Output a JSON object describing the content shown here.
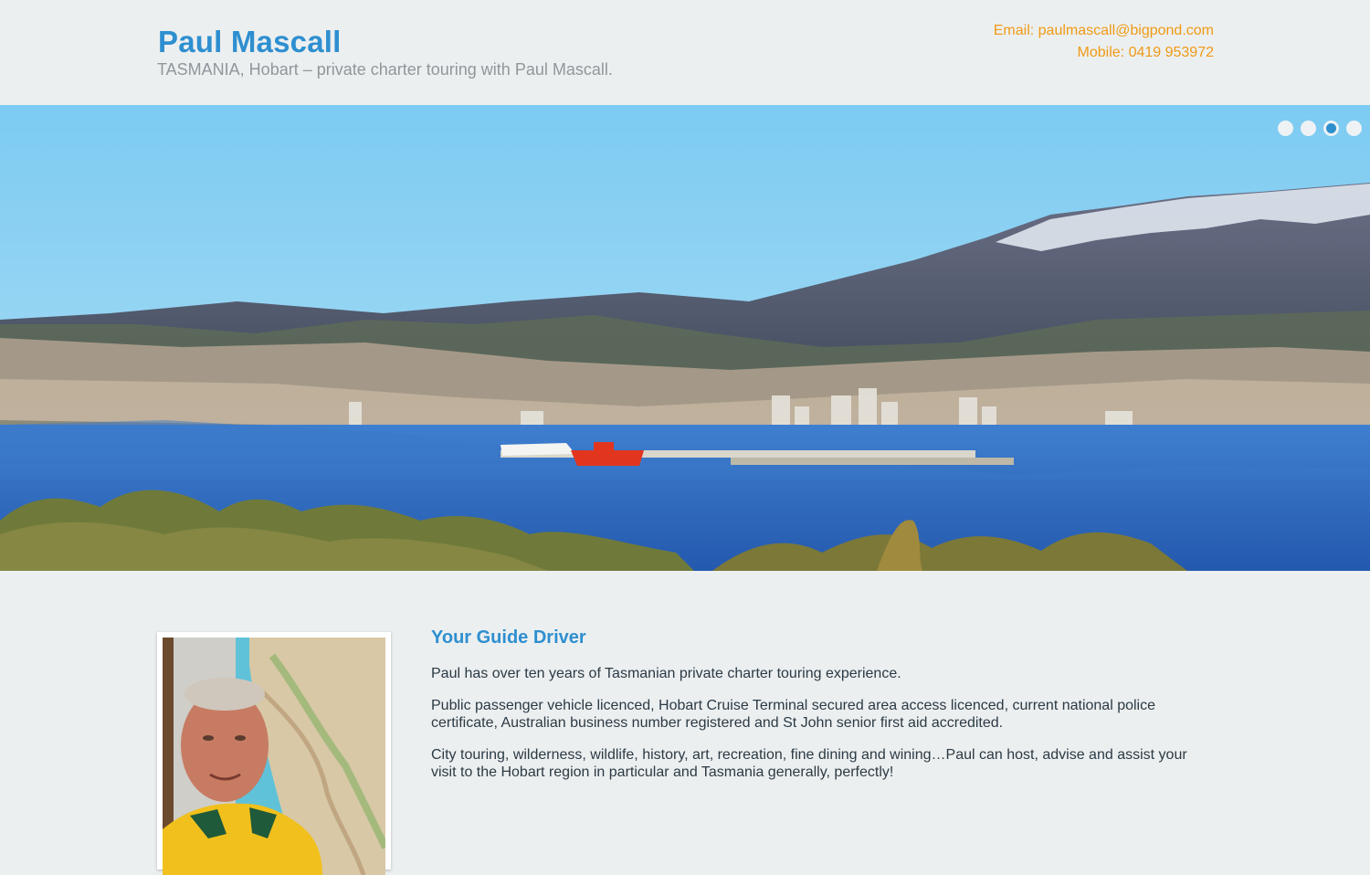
{
  "header": {
    "title": "Paul Mascall",
    "tagline": "TASMANIA, Hobart – private charter touring with Paul Mascall.",
    "email_label": "Email: ",
    "email": "paulmascall@bigpond.com",
    "mobile_label": "Mobile: ",
    "mobile": "0419 953972"
  },
  "slider": {
    "slide_count": 4,
    "active_index": 2
  },
  "main": {
    "section_title": "Your Guide Driver",
    "paragraphs": [
      "Paul has over ten years of Tasmanian private charter touring experience.",
      "Public passenger vehicle licenced, Hobart Cruise Terminal secured area access licenced, current national police certificate, Australian business number registered and St John senior first aid accredited.",
      "City touring, wilderness, wildlife, history, art, recreation, fine dining and wining…Paul can host, advise and assist your visit to the Hobart region in particular and Tasmania generally, perfectly!"
    ]
  },
  "colors": {
    "title_blue": "#2e8fd0",
    "contact_orange": "#ef9a15",
    "tagline_gray": "#8f979b",
    "body_text": "#2b3a44",
    "background": "#eceff0"
  }
}
